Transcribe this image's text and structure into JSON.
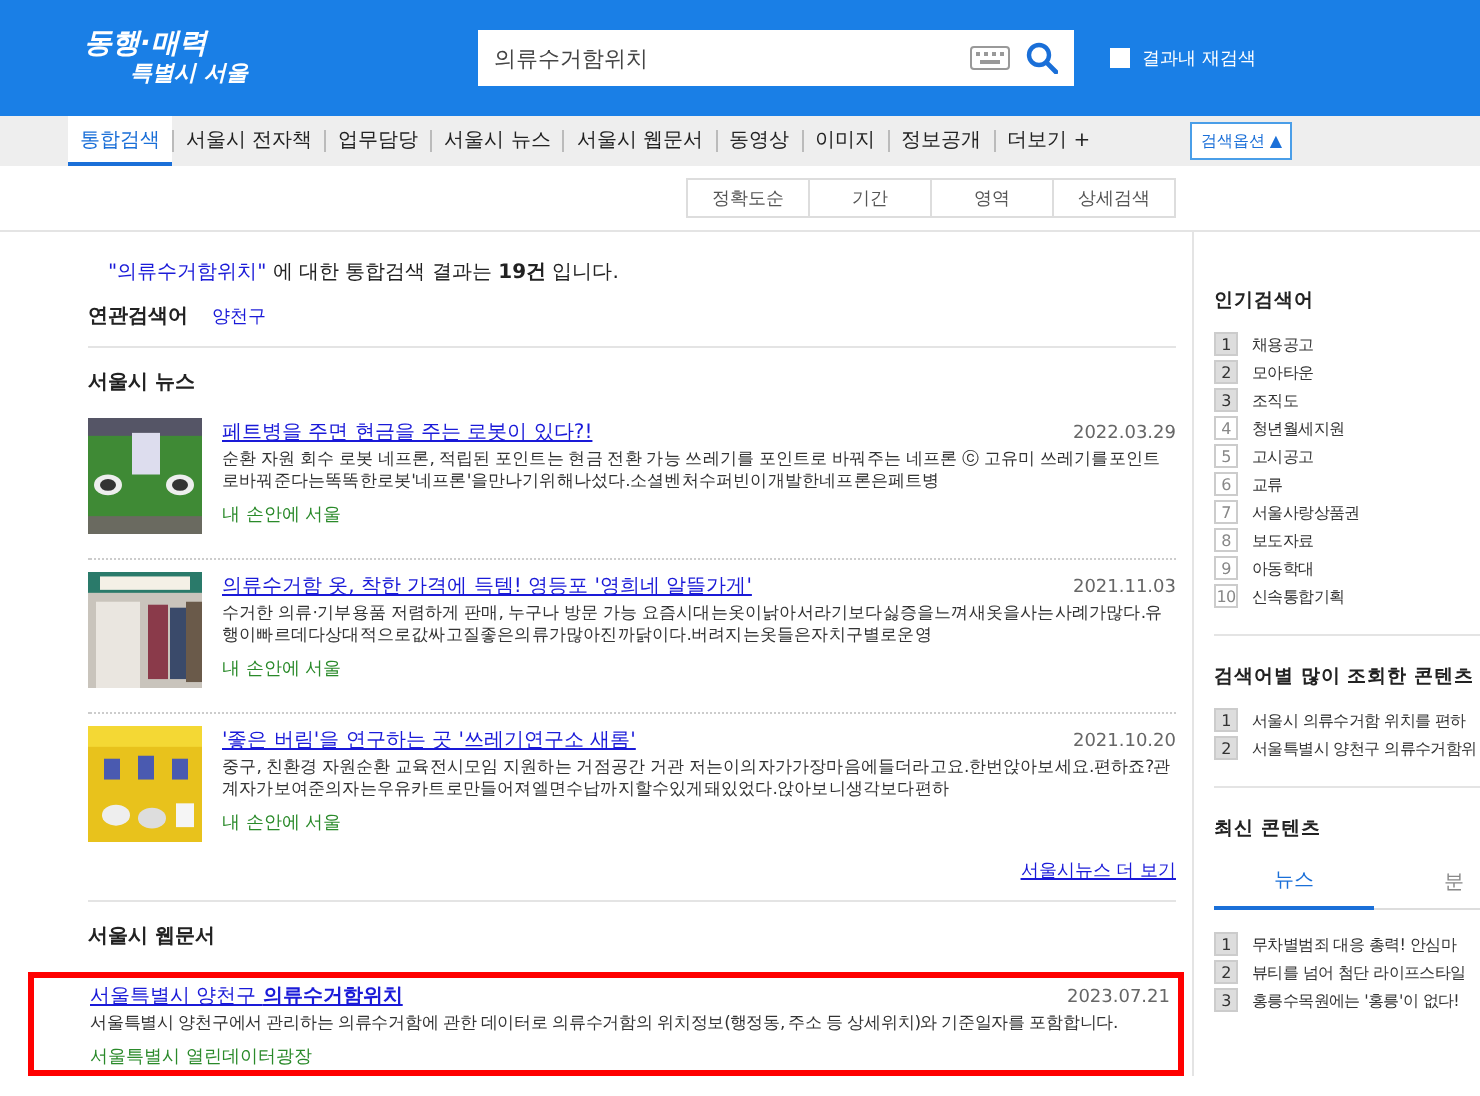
{
  "header": {
    "logo_line1": "동행·매력",
    "logo_line2": "특별시 서울",
    "search": {
      "value": "의류수거함위치"
    },
    "research": {
      "label": "결과내 재검색",
      "checked": false
    }
  },
  "nav": {
    "tabs": [
      {
        "label": "통합검색",
        "selected": true
      },
      {
        "label": "서울시 전자책",
        "selected": false
      },
      {
        "label": "업무담당",
        "selected": false
      },
      {
        "label": "서울시 뉴스",
        "selected": false
      },
      {
        "label": "서울시 웹문서",
        "selected": false
      },
      {
        "label": "동영상",
        "selected": false
      },
      {
        "label": "이미지",
        "selected": false
      },
      {
        "label": "정보공개",
        "selected": false
      },
      {
        "label": "더보기 +",
        "selected": false
      }
    ],
    "options_button": "검색옵션 ▲"
  },
  "sort_options": [
    "정확도순",
    "기간",
    "영역",
    "상세검색"
  ],
  "summary": {
    "query": "\"의류수거함위치\"",
    "text": "에 대한 통합검색 결과는 **19건** 입니다."
  },
  "related": {
    "label": "연관검색어",
    "terms": [
      "양천구"
    ]
  },
  "news": {
    "heading": "서울시 뉴스",
    "items": [
      {
        "title": "페트병을 주면 현금을 주는 로봇이 있다?!",
        "date": "2022.03.29",
        "snippet": "순환 자원 회수 로봇 네프론, 적립된 포인트는 현금 전환 가능 쓰레기를 포인트로 바꿔주는 네프론 ⓒ 고유미 쓰레기를포인트로바꿔준다는똑똑한로봇'네프론'을만나기위해나섰다.소셜벤처수퍼빈이개발한네프론은페트병",
        "source": "내 손안에 서울"
      },
      {
        "title": "의류수거함 옷, 착한 가격에 득템! 영등포 '영희네 알뜰가게'",
        "date": "2021.11.03",
        "snippet": "수거한 의류·기부용품 저렴하게 판매, 누구나 방문 가능 요즘시대는옷이낡아서라기보다싫증을느껴새옷을사는사례가많다.유행이빠르데다상대적으로값싸고질좋은의류가많아진까닭이다.버려지는옷들은자치구별로운영",
        "source": "내 손안에 서울"
      },
      {
        "title": "'좋은 버림'을 연구하는 곳 '쓰레기연구소 새롬'",
        "date": "2021.10.20",
        "snippet": "중구, 친환경 자원순환 교육전시모임 지원하는 거점공간 거관 저는이의자가가장마음에들더라고요.한번앉아보세요.편하죠?관계자가보여준의자는우유카트로만들어져엘면수납까지할수있게돼있었다.앉아보니생각보다편하",
        "source": "내 손안에 서울"
      }
    ],
    "more": "서울시뉴스 더 보기"
  },
  "webdocs": {
    "heading": "서울시 웹문서",
    "items": [
      {
        "title": "서울특별시 양천구 **의류수거함위치**",
        "date": "2023.07.21",
        "snippet": "서울특별시 양천구에서 관리하는 의류수거함에 관한 데이터로 의류수거함의 위치정보(행정동, 주소 등 상세위치)와 기준일자를 포함합니다.",
        "source": "서울특별시 열린데이터광장",
        "highlighted": true
      }
    ]
  },
  "sidebar": {
    "popular": {
      "heading": "인기검색어",
      "items": [
        {
          "rank": "1",
          "label": "채용공고",
          "highlighted": true
        },
        {
          "rank": "2",
          "label": "모아타운",
          "highlighted": true
        },
        {
          "rank": "3",
          "label": "조직도",
          "highlighted": true
        },
        {
          "rank": "4",
          "label": "청년월세지원",
          "highlighted": false
        },
        {
          "rank": "5",
          "label": "고시공고",
          "highlighted": false
        },
        {
          "rank": "6",
          "label": "교류",
          "highlighted": false
        },
        {
          "rank": "7",
          "label": "서울사랑상품권",
          "highlighted": false
        },
        {
          "rank": "8",
          "label": "보도자료",
          "highlighted": false
        },
        {
          "rank": "9",
          "label": "아동학대",
          "highlighted": false
        },
        {
          "rank": "10",
          "label": "신속통합기획",
          "highlighted": false
        }
      ]
    },
    "most_viewed": {
      "heading": "검색어별 많이 조회한 콘텐츠",
      "items": [
        {
          "rank": "1",
          "label": "서울시 의류수거함 위치를 편하"
        },
        {
          "rank": "2",
          "label": "서울특별시 양천구 의류수거함위"
        }
      ]
    },
    "latest": {
      "heading": "최신 콘텐츠",
      "tabs": [
        {
          "label": "뉴스",
          "selected": true
        },
        {
          "label": "분",
          "selected": false
        }
      ],
      "items": [
        {
          "rank": "1",
          "label": "무차별범죄 대응 총력! 안심마"
        },
        {
          "rank": "2",
          "label": "뷰티를 넘어 첨단 라이프스타일"
        },
        {
          "rank": "3",
          "label": "홍릉수목원에는 '홍릉'이 없다!"
        }
      ]
    }
  }
}
